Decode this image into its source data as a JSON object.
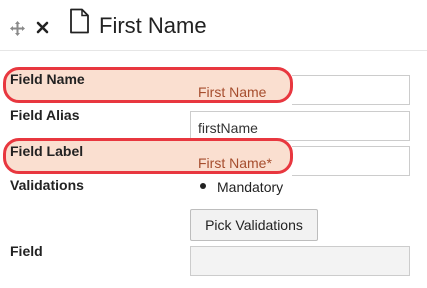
{
  "header": {
    "title": "First Name",
    "icons": [
      "move-icon",
      "close-icon",
      "document-icon"
    ]
  },
  "fields": {
    "field_name": {
      "label": "Field Name",
      "value": "First Name"
    },
    "field_alias": {
      "label": "Field Alias",
      "value": "firstName"
    },
    "field_label": {
      "label": "Field Label",
      "value": "First Name*"
    },
    "validations": {
      "label": "Validations",
      "items": [
        "Mandatory"
      ],
      "button_label": "Pick Validations"
    },
    "field": {
      "label": "Field",
      "value": ""
    }
  },
  "colors": {
    "highlight_border": "#e8373f",
    "highlight_fill": "#f6c4aa",
    "highlight_text": "#a64e2e"
  }
}
